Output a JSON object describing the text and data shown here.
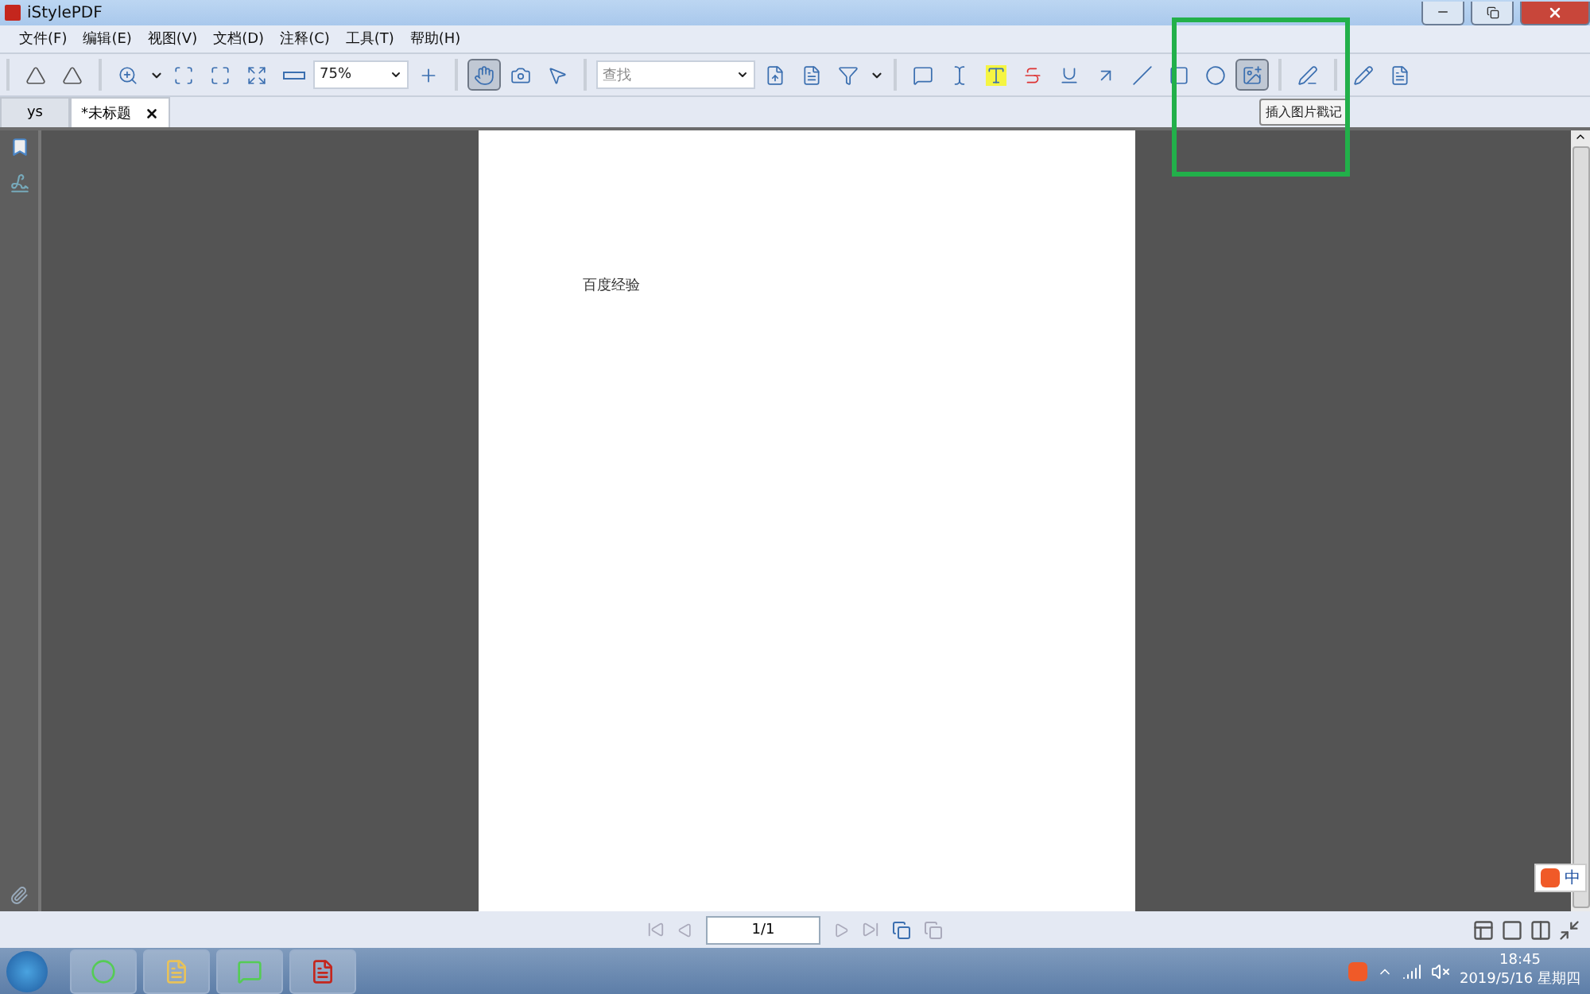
{
  "window": {
    "title": "iStylePDF"
  },
  "menu": [
    "文件(F)",
    "编辑(E)",
    "视图(V)",
    "文档(D)",
    "注释(C)",
    "工具(T)",
    "帮助(H)"
  ],
  "toolbar": [
    [
      {
        "kind": "rotate-left",
        "pressed": false
      },
      {
        "kind": "rotate-right",
        "pressed": false
      }
    ],
    [
      {
        "kind": "zoom-in",
        "pressed": false
      },
      {
        "kind": "caret"
      },
      {
        "kind": "fit-page",
        "pressed": false
      },
      {
        "kind": "fit-width",
        "pressed": false
      },
      {
        "kind": "fit-visible",
        "pressed": false
      },
      {
        "kind": "zoom-out",
        "pressed": false
      },
      {
        "kind": "zoom-field",
        "value": "75%"
      },
      {
        "kind": "zoom-plus",
        "pressed": false
      }
    ],
    [
      {
        "kind": "hand",
        "pressed": true
      },
      {
        "kind": "snapshot",
        "pressed": false
      },
      {
        "kind": "select",
        "pressed": false
      }
    ],
    [
      {
        "kind": "search-field",
        "placeholder": "查找"
      },
      {
        "kind": "prev-result",
        "pressed": false
      },
      {
        "kind": "next-result",
        "pressed": false
      },
      {
        "kind": "filter",
        "pressed": false
      },
      {
        "kind": "caret"
      }
    ],
    [
      {
        "kind": "note",
        "pressed": false
      },
      {
        "kind": "text-insert",
        "pressed": false
      },
      {
        "kind": "highlight",
        "pressed": false
      },
      {
        "kind": "strike",
        "pressed": false
      },
      {
        "kind": "underline",
        "pressed": false
      },
      {
        "kind": "arrow",
        "pressed": false
      },
      {
        "kind": "line",
        "pressed": false
      },
      {
        "kind": "rect",
        "pressed": false
      },
      {
        "kind": "ellipse",
        "pressed": false
      },
      {
        "kind": "stamp",
        "pressed": true,
        "tooltip": "插入图片戳记"
      }
    ],
    [
      {
        "kind": "sign",
        "pressed": false
      }
    ],
    [
      {
        "kind": "pen",
        "pressed": false
      },
      {
        "kind": "review",
        "pressed": false
      }
    ]
  ],
  "tabs": [
    {
      "label": "ys",
      "selected": false
    },
    {
      "label": "*未标题",
      "selected": true
    }
  ],
  "document": {
    "text": "百度经验"
  },
  "pager": {
    "page": "1/1"
  },
  "ime": {
    "mode": "中"
  },
  "clock": {
    "time": "18:45",
    "date": "2019/5/16 星期四"
  }
}
